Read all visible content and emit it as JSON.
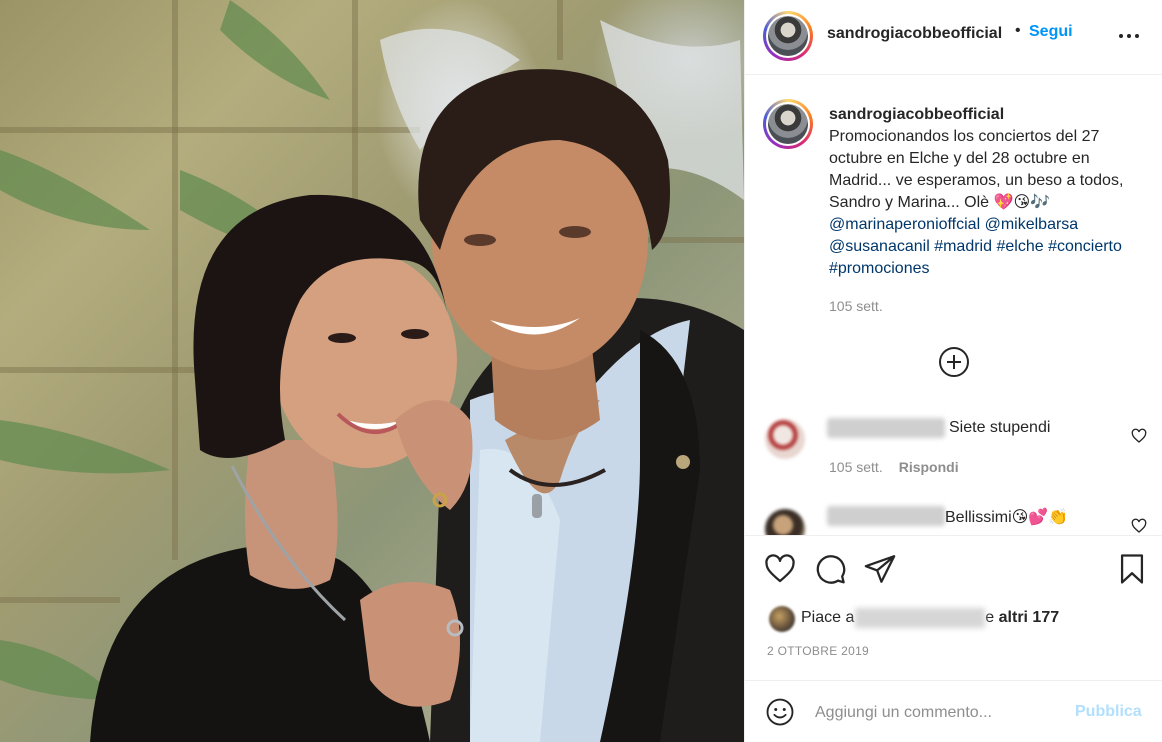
{
  "photo": {
    "description_icon": "photo"
  },
  "header": {
    "username": "sandrogiacobbeofficial",
    "separator": "•",
    "follow_label": "Segui",
    "more_label": "•••"
  },
  "caption": {
    "username": "sandrogiacobbeofficial",
    "text": "Promocionandos los conciertos del 27 octubre en Elche y del 28 octubre en Madrid... ve esperamos, un beso a todos, Sandro y Marina... Olè 💖😘🎶",
    "tags": [
      "@marinaperonioffcial",
      "@mikelbarsa",
      "@susanacanil",
      "#madrid",
      "#elche",
      "#concierto",
      "#promociones"
    ],
    "time": "105 sett."
  },
  "comments": [
    {
      "text": "Siete stupendi",
      "time": "105 sett.",
      "reply_label": "Rispondi"
    },
    {
      "text": "Bellissimi😘💕👏"
    }
  ],
  "actions": {
    "likes_prefix": "Piace a",
    "likes_suffix": "e",
    "likes_others": "altri 177",
    "date": "2 OTTOBRE 2019"
  },
  "composer": {
    "placeholder": "Aggiungi un commento...",
    "publish_label": "Pubblica"
  },
  "colors": {
    "link": "#0095f6",
    "tag": "#00376b",
    "muted": "#8e8e8e",
    "text": "#262626",
    "publish_disabled": "#b2dffc"
  }
}
